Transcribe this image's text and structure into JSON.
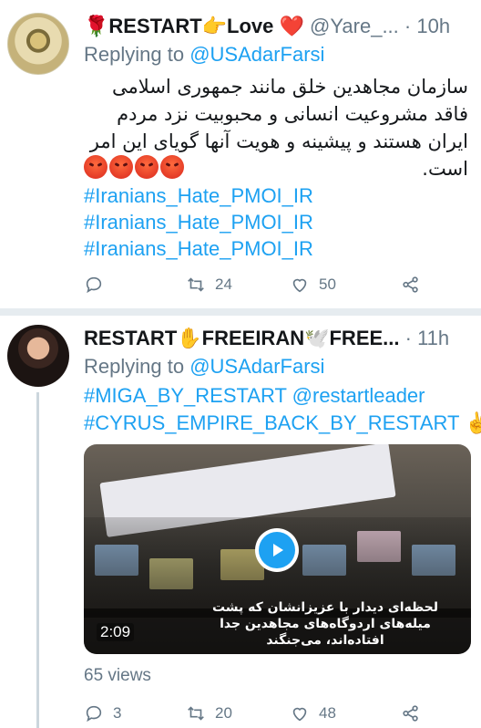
{
  "tweet1": {
    "display_name": "🌹RESTART👉Love ❤️",
    "handle": "@Yare_...",
    "time": "· 10h",
    "replying_prefix": "Replying to ",
    "replying_mention": "@USAdarFarsi",
    "text": "سازمان مجاهدین خلق مانند جمهوری اسلامی فاقد مشروعیت انسانی و محبوبیت نزد مردم ایران هستند و پیشینه و هویت آنها گویای این امر است.",
    "emoji_count": 4,
    "hashtags": [
      "#Iranians_Hate_PMOI_IR",
      "#Iranians_Hate_PMOI_IR",
      "#Iranians_Hate_PMOI_IR"
    ],
    "actions": {
      "reply": "",
      "retweet": "24",
      "like": "50"
    }
  },
  "tweet2": {
    "display_name": "RESTART✋FREEIRAN🕊️FREE...",
    "time": "· 11h",
    "replying_prefix": "Replying to ",
    "replying_mention": "@USAdarFarsi",
    "line1_hashtag": "#MIGA_BY_RESTART",
    "line1_mention": "@restartleader",
    "line2_hashtag": "#CYRUS_EMPIRE_BACK_BY_RESTART",
    "line2_emoji": "✌️",
    "video": {
      "duration": "2:09",
      "caption": "لحظه‌ای دیدار با عزیزانشان که پشت میله‌های اردوگاه‌های مجاهدین جدا افتاده‌اند، می‌جنگند"
    },
    "views": "65 views",
    "actions": {
      "reply": "3",
      "retweet": "20",
      "like": "48"
    }
  }
}
